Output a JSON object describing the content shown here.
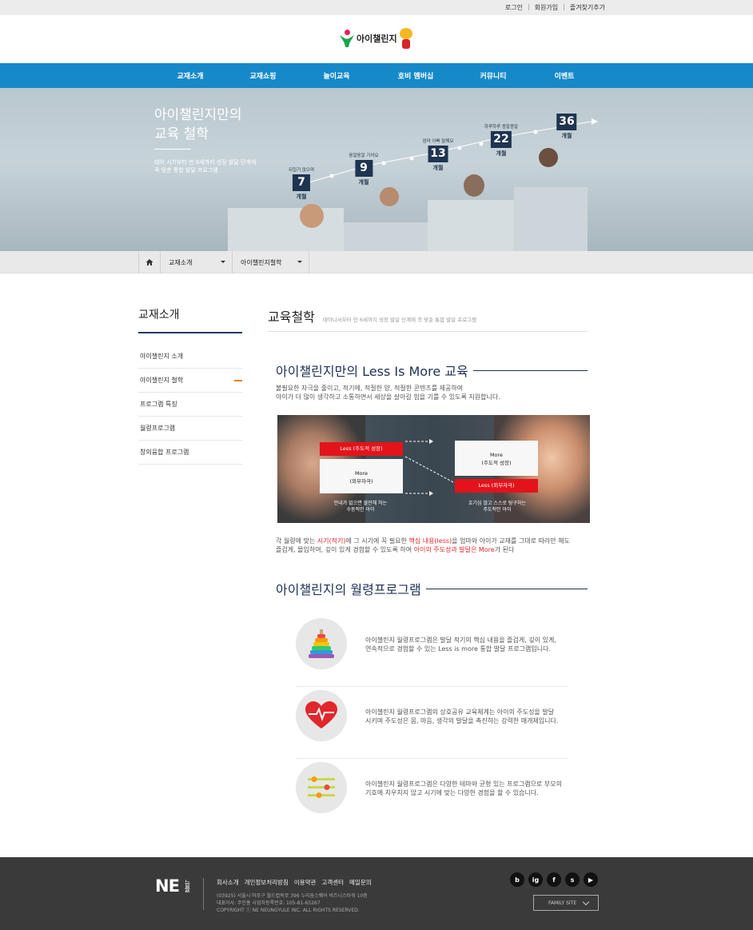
{
  "util": {
    "login": "로그인",
    "join": "회원가입",
    "favorite": "즐겨찾기추가",
    "sep": "|"
  },
  "logo": {
    "text": "아이챌린지"
  },
  "gnb": [
    "교재소개",
    "교재쇼핑",
    "놀이교육",
    "호비 멤버십",
    "커뮤니티",
    "이벤트"
  ],
  "hero": {
    "title1": "아이챌린지만의",
    "title2": "교육 철학",
    "desc1": "태아 시기부터 만 6세까지 성장 발달 단계에",
    "desc2": "꼭 맞춘 통합 발달 프로그램",
    "milestones": [
      {
        "caption": "뒤집기 앉으며",
        "num": "7",
        "unit": "개월"
      },
      {
        "caption": "옹알옹알 기어요",
        "num": "9",
        "unit": "개월"
      },
      {
        "caption": "엄마 아빠 말해요",
        "num": "13",
        "unit": "개월"
      },
      {
        "caption": "하루하루 종알종알",
        "num": "22",
        "unit": "개월"
      },
      {
        "caption": "",
        "num": "36",
        "unit": "개월"
      }
    ]
  },
  "location": {
    "dd1": "교재소개",
    "dd2": "아이챌린지철학"
  },
  "side": {
    "title": "교재소개",
    "items": [
      "아이챌린지 소개",
      "아이챌린지 철학",
      "프로그램 특징",
      "월령프로그램",
      "창의융합 프로그램"
    ]
  },
  "content": {
    "title": "교육철학",
    "subtitle": "태아나서부터 만 6세까지 성장 발달 단계에 꼭 맞춘 통합 발달 프로그램",
    "sec1_title": "아이챌린지만의 Less Is More 교육",
    "sec1_p1": "불필요한 자극을 줄이고, 적기에, 적절한 양, 적절한 콘텐츠를 제공하여",
    "sec1_p2": "아이가 더 많이 생각하고 소통하면서 세상을 살아갈 힘을 기를 수 있도록 지원합니다.",
    "diagram": {
      "less_left": "Less (주도적 성장)",
      "more_left_1": "More",
      "more_left_2": "(외부자극)",
      "more_right_1": "More",
      "more_right_2": "(주도적 성장)",
      "less_right": "Less (외부자극)",
      "cap_left_1": "안내가 없으면 불안해 하는",
      "cap_left_2": "수동적인 아이",
      "cap_right_1": "호기심 많고 스스로 탐구하는",
      "cap_right_2": "주도적인 아이"
    },
    "sec1_p3a": "각 월령에 맞는 ",
    "sec1_p3_red1": "시기(적기)",
    "sec1_p3b": "에 그 시기에 꼭 필요한 ",
    "sec1_p3_red2": "핵심 내용(less)",
    "sec1_p3c": "을 엄마와 아이가 교재를 그대로 따라만 해도",
    "sec1_p4a": "즐겁게, 몰입하여, 깊이 있게 경험할 수 있도록 하여 ",
    "sec1_p4_red": "아이의 주도성과 발달은 More",
    "sec1_p4b": "가 된다",
    "sec2_title": "아이챌린지의 월령프로그램",
    "items": [
      {
        "icon": "ring-stack-icon",
        "l1": "아이챌린지 월령프로그램은 발달 적기의 핵심 내용을 즐겁게, 깊이 있게,",
        "l2": "연속적으로 경험할 수 있는 Less is more 통합 발달 프로그램입니다."
      },
      {
        "icon": "heart-pulse-icon",
        "l1": "아이챌린지 월령프로그램의 상호공유 교육체계는 아이의 주도성을 발달",
        "l2": "시키며 주도성은 몸, 마음, 생각의 발달을 촉진하는 강력한 매개체입니다."
      },
      {
        "icon": "slider-icon",
        "l1": "아이챌린지 월령프로그램은 다양한 테마와 균형 있는 프로그램으로 부모의",
        "l2": "기호에 치우치지 않고 시기에 맞는 다양한 경험을 할 수 있습니다."
      }
    ]
  },
  "footer": {
    "ne": "NE",
    "neungyule": "능률",
    "links": [
      "회사소개",
      "개인정보처리방침",
      "이용약관",
      "고객센터",
      "메일문의"
    ],
    "addr1": "(03925) 서울시 마포구 월드컵북로 396 누리꿈스퀘어 비즈니스타워 10층",
    "addr2": "대표이사: 주민홍 사업자등록번호: 105-81-65267",
    "copyright": "COPYRIGHT ⓒ NE NEUNGYULE INC. ALL RIGHTS RESERVED.",
    "sns": [
      "b",
      "ig",
      "f",
      "s",
      "▶"
    ],
    "family_site": "FAMILY SITE"
  },
  "colors": {
    "nav": "#1689c9",
    "navy": "#1e3156",
    "accent_red": "#e0272c",
    "orange": "#ee7d1e",
    "footer_bg": "#3a3a3a"
  }
}
